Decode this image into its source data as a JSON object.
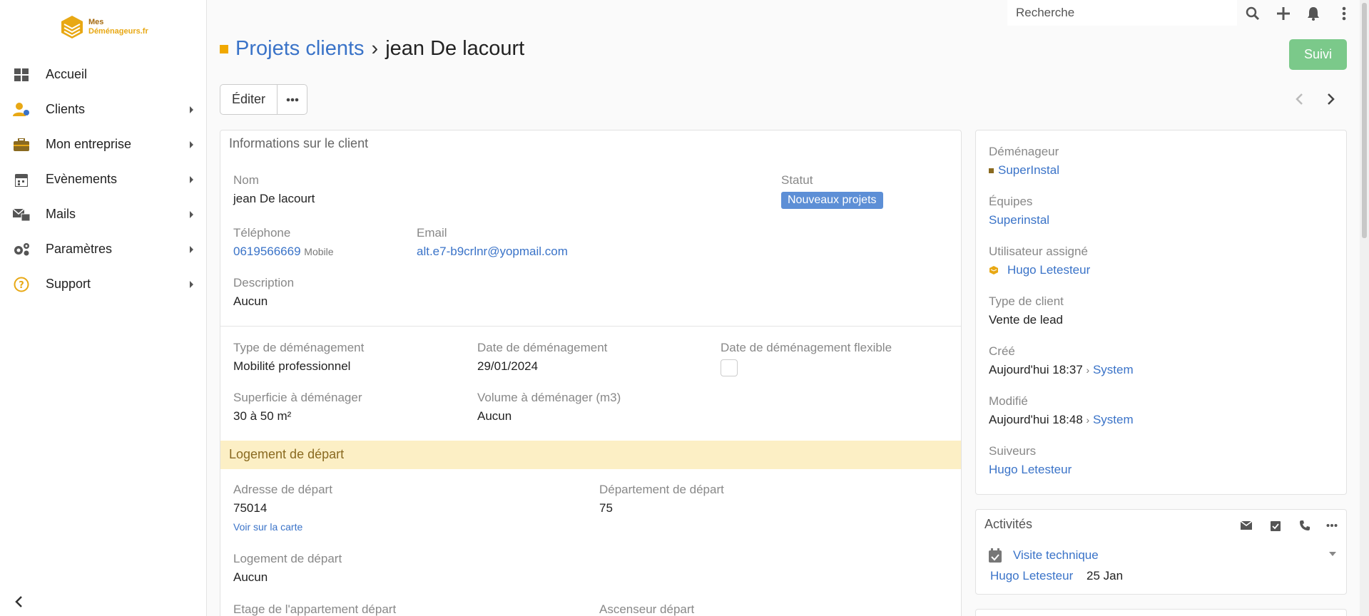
{
  "logo": {
    "line1": "Mes",
    "line2": "Déménageurs.fr"
  },
  "sidebar": {
    "items": [
      {
        "label": "Accueil",
        "icon": "dashboard-icon"
      },
      {
        "label": "Clients",
        "icon": "clients-icon"
      },
      {
        "label": "Mon entreprise",
        "icon": "briefcase-icon"
      },
      {
        "label": "Evènements",
        "icon": "calendar-icon"
      },
      {
        "label": "Mails",
        "icon": "mail-icon"
      },
      {
        "label": "Paramètres",
        "icon": "gears-icon"
      },
      {
        "label": "Support",
        "icon": "help-icon"
      }
    ]
  },
  "topbar": {
    "search_placeholder": "Recherche"
  },
  "header": {
    "breadcrumb": "Projets clients",
    "separator": "›",
    "title": "jean De lacourt",
    "suivi_label": "Suivi",
    "edit_label": "Éditer"
  },
  "client_info": {
    "section_title": "Informations sur le client",
    "nom_label": "Nom",
    "nom_value": "jean De lacourt",
    "statut_label": "Statut",
    "statut_value": "Nouveaux projets",
    "tel_label": "Téléphone",
    "tel_value": "0619566669",
    "tel_type": "Mobile",
    "email_label": "Email",
    "email_value": "alt.e7-b9crlnr@yopmail.com",
    "desc_label": "Description",
    "desc_value": "Aucun"
  },
  "move": {
    "type_label": "Type de déménagement",
    "type_value": "Mobilité professionnel",
    "date_label": "Date de déménagement",
    "date_value": "29/01/2024",
    "flex_label": "Date de déménagement flexible",
    "surface_label": "Superficie à déménager",
    "surface_value": "30 à 50 m²",
    "volume_label": "Volume à déménager (m3)",
    "volume_value": "Aucun"
  },
  "departure": {
    "section_title": "Logement de départ",
    "address_label": "Adresse de départ",
    "address_value": "75014",
    "map_link": "Voir sur la carte",
    "dept_label": "Département de départ",
    "dept_value": "75",
    "logement_label": "Logement de départ",
    "logement_value": "Aucun",
    "etage_label": "Etage de l'appartement départ",
    "ascenseur_label": "Ascenseur départ"
  },
  "side": {
    "demenageur_label": "Déménageur",
    "demenageur_value": "SuperInstal",
    "equipes_label": "Équipes",
    "equipes_value": "Superinstal",
    "user_label": "Utilisateur assigné",
    "user_value": "Hugo Letesteur",
    "type_label": "Type de client",
    "type_value": "Vente de lead",
    "cree_label": "Créé",
    "cree_value": "Aujourd'hui 18:37",
    "cree_by": "System",
    "modif_label": "Modifié",
    "modif_value": "Aujourd'hui 18:48",
    "modif_by": "System",
    "suiveurs_label": "Suiveurs",
    "suiveurs_value": "Hugo Letesteur",
    "by_sep": "›"
  },
  "activities": {
    "title": "Activités",
    "item_title": "Visite technique",
    "item_user": "Hugo Letesteur",
    "item_date": "25 Jan"
  },
  "colors": {
    "accent": "#3a73c8",
    "suivi": "#7bc98a",
    "badge": "#5d8fd6",
    "band": "#fcefc5",
    "brand": "#f0a800"
  }
}
